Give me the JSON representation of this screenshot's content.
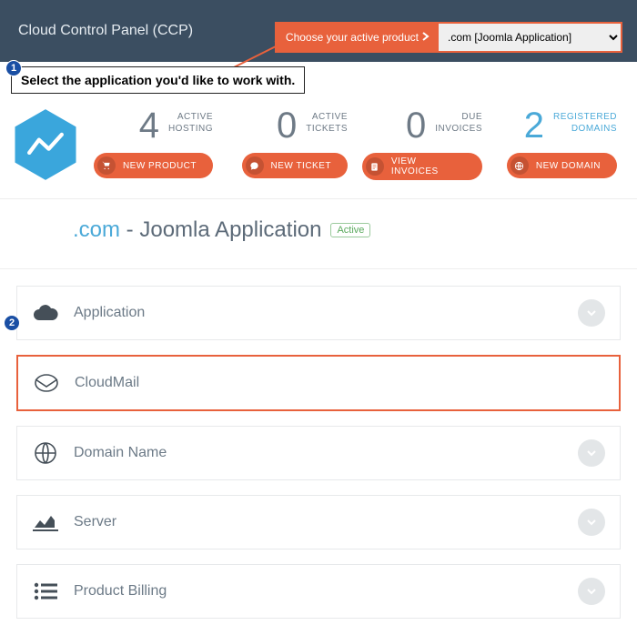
{
  "header": {
    "title": "Cloud Control Panel (CCP)",
    "chooser_label": "Choose your active product",
    "chooser_selected": ".com [Joomla Application]"
  },
  "callouts": {
    "c1_text": "Select the application you'd like to work with.",
    "c1_num": "1",
    "c2_num": "2"
  },
  "stats": {
    "hosting": {
      "num": "4",
      "l1": "ACTIVE",
      "l2": "HOSTING",
      "btn": "NEW PRODUCT"
    },
    "tickets": {
      "num": "0",
      "l1": "ACTIVE",
      "l2": "TICKETS",
      "btn": "NEW TICKET"
    },
    "invoices": {
      "num": "0",
      "l1": "DUE",
      "l2": "INVOICES",
      "btn": "VIEW INVOICES"
    },
    "domains": {
      "num": "2",
      "l1": "REGISTERED",
      "l2": "DOMAINS",
      "btn": "NEW DOMAIN"
    }
  },
  "domain_row": {
    "suffix": ".com",
    "sep": " - ",
    "app": "Joomla Application",
    "badge": "Active"
  },
  "panels": {
    "application": "Application",
    "cloudmail": "CloudMail",
    "domain": "Domain Name",
    "server": "Server",
    "billing": "Product Billing"
  }
}
